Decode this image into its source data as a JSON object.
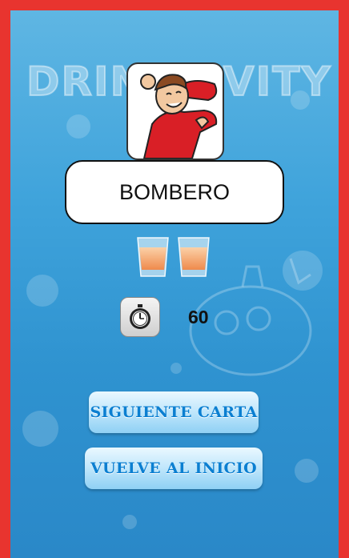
{
  "background_logo": "DRINKTIVITY",
  "card": {
    "word": "BOMBERO"
  },
  "shots": {
    "count": 2,
    "color": "#f39a5f"
  },
  "timer": {
    "icon": "stopwatch-icon",
    "value": "60"
  },
  "buttons": {
    "next": "SIGUIENTE CARTA",
    "home": "VUELVE AL INICIO"
  },
  "colors": {
    "frame": "#e8342f",
    "background": "#3fa3db",
    "button_text": "#0b7fd1"
  }
}
